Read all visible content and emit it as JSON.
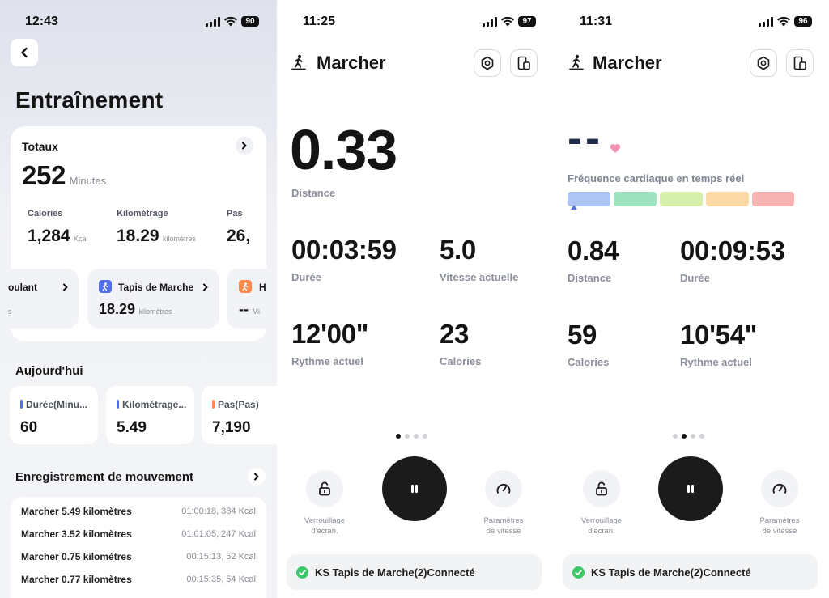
{
  "colors": {
    "accent_blue": "#4f6ee8",
    "accent_orange": "#ff8a4c",
    "connected_green": "#3cc86a",
    "heart_pink": "#f28fb4",
    "zones": [
      "#aec4f5",
      "#9ee2bf",
      "#d6f0ac",
      "#fbd8a4",
      "#f7b2b2"
    ]
  },
  "panel1": {
    "time": "12:43",
    "battery": "90",
    "title": "Entraînement",
    "totals": {
      "label": "Totaux",
      "minutes_value": "252",
      "minutes_unit": "Minutes",
      "stats": [
        {
          "label": "Calories",
          "value": "1,284",
          "unit": "Kcal"
        },
        {
          "label": "Kilométrage",
          "value": "18.29",
          "unit": "kilomètres"
        },
        {
          "label": "Pas",
          "value": "26,",
          "unit": ""
        }
      ],
      "devices": [
        {
          "label": "oulant",
          "unit": "s"
        },
        {
          "label": "Tapis de Marche",
          "value": "18.29",
          "unit": "kilomètres",
          "icon": "walking-person-icon"
        },
        {
          "label": "H",
          "value": "--",
          "unit": "Mi",
          "icon": "walking-person-icon"
        }
      ]
    },
    "today": {
      "title": "Aujourd'hui",
      "cards": [
        {
          "label": "Durée(Minu...",
          "value": "60",
          "color": "#4f6ee8"
        },
        {
          "label": "Kilométrage...",
          "value": "5.49",
          "color": "#4f6ee8"
        },
        {
          "label": "Pas(Pas)",
          "value": "7,190",
          "color": "#ff8a4c"
        }
      ]
    },
    "records": {
      "title": "Enregistrement de mouvement",
      "rows": [
        {
          "left": "Marcher 5.49 kilomètres",
          "right": "01:00:18, 384 Kcal"
        },
        {
          "left": "Marcher 3.52 kilomètres",
          "right": "01:01:05, 247 Kcal"
        },
        {
          "left": "Marcher 0.75 kilomètres",
          "right": "00:15:13, 52 Kcal"
        },
        {
          "left": "Marcher 0.77 kilomètres",
          "right": "00:15:35, 54 Kcal"
        }
      ]
    }
  },
  "panel2": {
    "time": "11:25",
    "battery": "97",
    "title": "Marcher",
    "main_value": "0.33",
    "main_label": "Distance",
    "metrics": [
      {
        "value": "00:03:59",
        "label": "Durée"
      },
      {
        "value": "5.0",
        "label": "Vitesse actuelle"
      },
      {
        "value": "12'00\"",
        "label": "Rythme actuel"
      },
      {
        "value": "23",
        "label": "Calories"
      }
    ],
    "page_index": 0,
    "lock_label": [
      "Verrouillage",
      "d'écran."
    ],
    "speed_label": [
      "Paramètres",
      "de vitesse"
    ],
    "connection": "KS Tapis de Marche(2)Connecté"
  },
  "panel3": {
    "time": "11:31",
    "battery": "96",
    "title": "Marcher",
    "hr_value": "--",
    "hr_label": "Fréquence cardiaque en temps réel",
    "metrics": [
      {
        "value": "0.84",
        "label": "Distance"
      },
      {
        "value": "00:09:53",
        "label": "Durée"
      },
      {
        "value": "59",
        "label": "Calories"
      },
      {
        "value": "10'54\"",
        "label": "Rythme actuel"
      }
    ],
    "page_index": 1,
    "lock_label": [
      "Verrouillage",
      "d'écran."
    ],
    "speed_label": [
      "Paramètres",
      "de vitesse"
    ],
    "connection": "KS Tapis de Marche(2)Connecté"
  }
}
